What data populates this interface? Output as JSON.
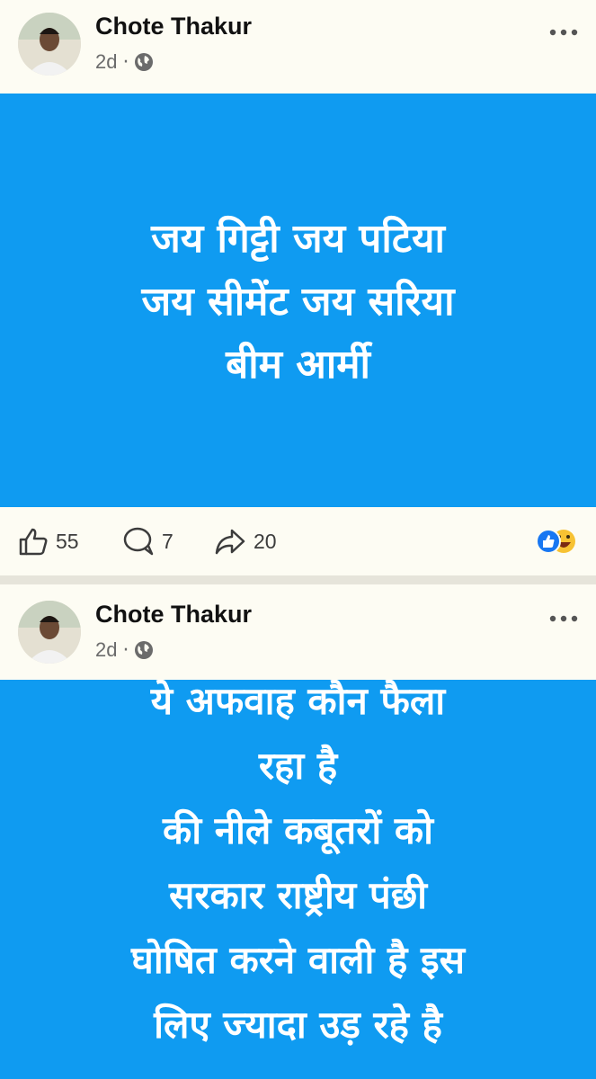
{
  "posts": [
    {
      "author": "Chote Thakur",
      "time": "2d",
      "separator": "·",
      "image_text_lines": [
        "जय गिट्टी जय पटिया",
        "जय सीमेंट जय सरिया",
        "बीम आर्मी"
      ],
      "likes": "55",
      "comments": "7",
      "shares": "20",
      "image_bg": "#0f9bf1"
    },
    {
      "author": "Chote Thakur",
      "time": "2d",
      "separator": "·",
      "image_text_lines": [
        "ये अफवाह कौन फैला",
        "रहा है",
        "की नीले कबूतरों को",
        "सरकार राष्ट्रीय पंछी",
        "घोषित करने वाली है इस",
        "लिए ज्यादा उड़ रहे है"
      ],
      "image_bg": "#0f9bf1"
    }
  ],
  "icons": {
    "globe": "globe-icon",
    "more": "more-options-icon",
    "like": "thumbs-up-icon",
    "comment": "comment-icon",
    "share": "share-icon",
    "reactions": "reactions-icon"
  }
}
